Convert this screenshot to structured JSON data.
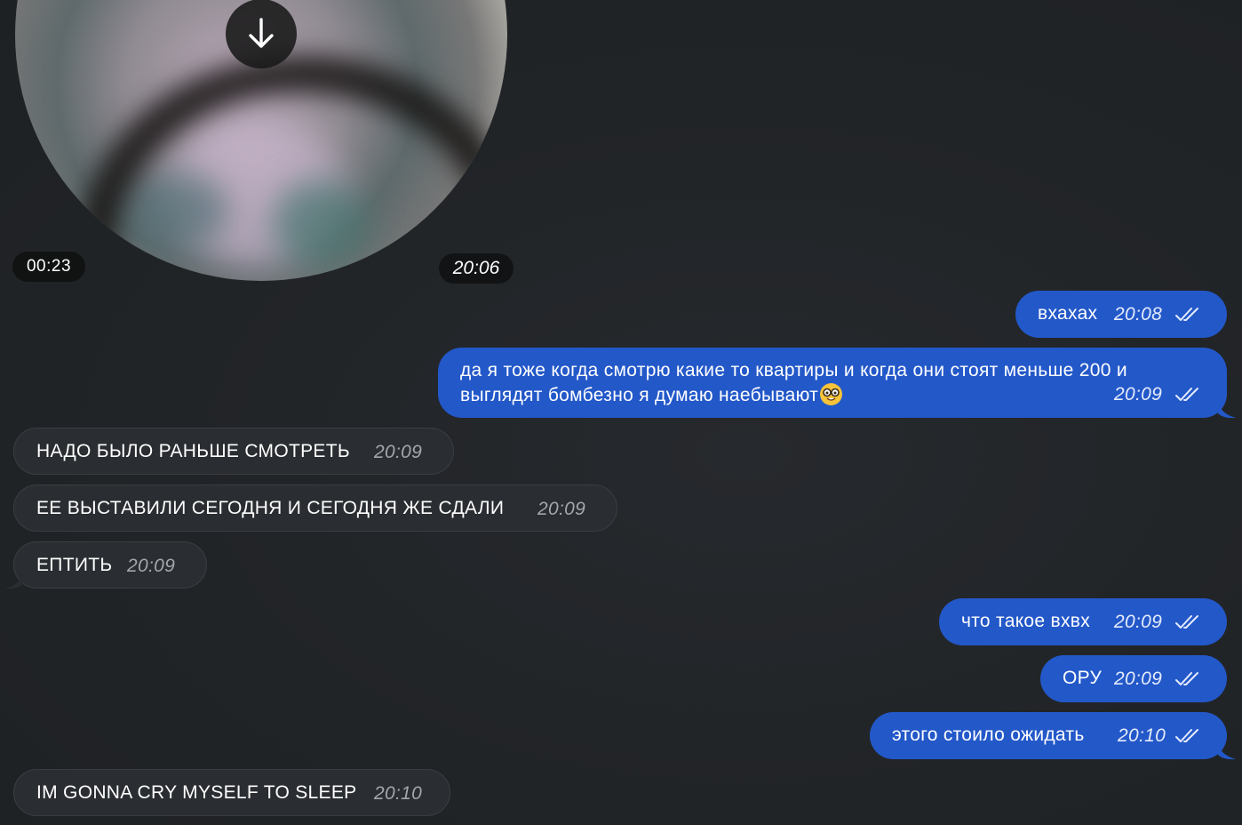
{
  "video_message": {
    "duration": "00:23",
    "time": "20:06"
  },
  "messages": [
    {
      "dir": "out",
      "text": "вхахах",
      "time": "20:08"
    },
    {
      "dir": "out",
      "line1": "да я тоже когда смотрю какие то квартиры и когда они стоят меньше 200 и",
      "line2": "выглядят бомбезно я думаю наебывают",
      "emoji": "nerd-face-icon",
      "time": "20:09"
    },
    {
      "dir": "in",
      "text": "НАДО БЫЛО РАНЬШЕ СМОТРЕТЬ",
      "time": "20:09"
    },
    {
      "dir": "in",
      "text": "ЕЕ ВЫСТАВИЛИ СЕГОДНЯ И СЕГОДНЯ ЖЕ СДАЛИ",
      "time": "20:09"
    },
    {
      "dir": "in",
      "text": "ЕПТИТЬ",
      "time": "20:09"
    },
    {
      "dir": "out",
      "text": "что такое вхвх",
      "time": "20:09"
    },
    {
      "dir": "out",
      "text": "ОРУ",
      "time": "20:09"
    },
    {
      "dir": "out",
      "text": "этого стоило ожидать",
      "time": "20:10"
    },
    {
      "dir": "in",
      "text": "IM GONNA CRY MYSELF TO SLEEP",
      "time": "20:10"
    }
  ],
  "colors": {
    "background": "#212427",
    "outgoing_bubble": "#2358c9",
    "incoming_bubble": "#2a2d31"
  },
  "icons": {
    "download": "arrow-down-icon",
    "read_receipt": "double-check-icon",
    "emoji": "nerd-face-icon"
  }
}
